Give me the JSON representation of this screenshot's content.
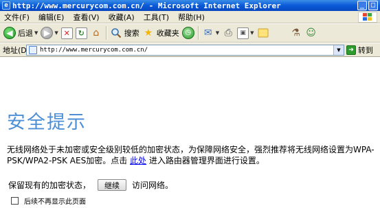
{
  "window": {
    "title": "http://www.mercurycom.com.cn/ - Microsoft Internet Explorer",
    "minimize_glyph": "_",
    "maximize_glyph": "□"
  },
  "menu": {
    "items": [
      "文件(F)",
      "编辑(E)",
      "查看(V)",
      "收藏(A)",
      "工具(T)",
      "帮助(H)"
    ]
  },
  "toolbar": {
    "back_label": "后退",
    "search_label": "搜索",
    "favorites_label": "收藏夹"
  },
  "address": {
    "label": "地址(D)",
    "url": "http://www.mercurycom.com.cn/",
    "go_label": "转到"
  },
  "page": {
    "heading": "安全提示",
    "para_before_link": "无线网络处于未加密或安全级别较低的加密状态，为保障网络安全，强烈推荐将无线网络设置为WPA-PSK/WPA2-PSK AES加密。点击 ",
    "link_text": "此处",
    "para_after_link": " 进入路由器管理界面进行设置。",
    "keep_before": "保留现有的加密状态，",
    "continue_button": "继续",
    "keep_after": "访问网络。",
    "checkbox_label": "后续不再显示此页面"
  },
  "icons": {
    "app": "ie-icon",
    "back": "back-arrow-icon",
    "forward": "forward-arrow-icon",
    "stop": "stop-icon",
    "refresh": "refresh-icon",
    "home": "home-icon",
    "search": "search-icon",
    "favorites": "star-icon",
    "history": "history-icon",
    "mail": "mail-icon",
    "print": "print-icon",
    "edit": "edit-icon",
    "folder": "folder-icon",
    "messenger": "messenger-icon"
  }
}
